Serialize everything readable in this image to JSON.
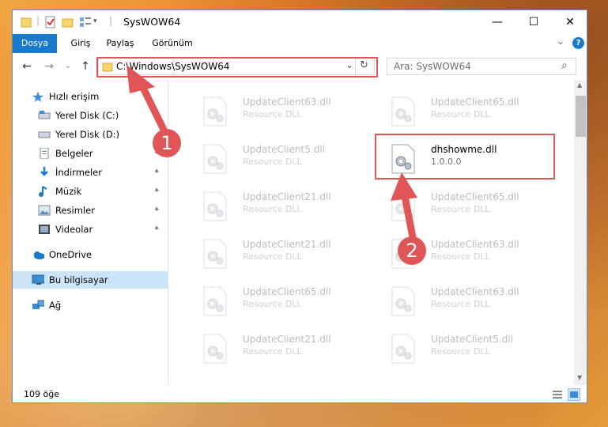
{
  "window": {
    "title": "SysWOW64",
    "minimize": "—",
    "maximize": "☐",
    "close": "✕"
  },
  "ribbon": {
    "tabs": [
      "Dosya",
      "Giriş",
      "Paylaş",
      "Görünüm"
    ],
    "expand": "⌄",
    "help": "?"
  },
  "nav": {
    "back": "←",
    "forward": "→",
    "recent": "⌄",
    "up": "↑",
    "address": "C:\\Windows\\SysWOW64",
    "dropdown": "⌄",
    "refresh": "↻",
    "search_placeholder": "Ara: SysWOW64",
    "search_icon": "⌕"
  },
  "sidebar": {
    "items": [
      {
        "label": "Hızlı erişim",
        "icon": "star-icon"
      },
      {
        "label": "Yerel Disk (C:)",
        "icon": "drive-icon",
        "pinned": true
      },
      {
        "label": "Yerel Disk (D:)",
        "icon": "drive-icon",
        "pinned": false
      },
      {
        "label": "Belgeler",
        "icon": "documents-icon",
        "pinned": true
      },
      {
        "label": "İndirmeler",
        "icon": "downloads-icon",
        "pinned": true
      },
      {
        "label": "Müzik",
        "icon": "music-icon",
        "pinned": true
      },
      {
        "label": "Resimler",
        "icon": "pictures-icon",
        "pinned": true
      },
      {
        "label": "Videolar",
        "icon": "videos-icon",
        "pinned": true
      },
      {
        "label": "OneDrive",
        "icon": "cloud-icon"
      },
      {
        "label": "Bu bilgisayar",
        "icon": "computer-icon"
      },
      {
        "label": "Ağ",
        "icon": "network-icon"
      }
    ],
    "pin_glyph": "📌"
  },
  "files": [
    {
      "name": "UpdateClient63.dll",
      "desc": "Resource DLL"
    },
    {
      "name": "UpdateClient65.dll",
      "desc": "Resource DLL"
    },
    {
      "name": "UpdateClient5.dll",
      "desc": "Resource DLL"
    },
    {
      "name": "dhshowme.dll",
      "desc": "1.0.0.0"
    },
    {
      "name": "UpdateClient21.dll",
      "desc": "Resource DLL"
    },
    {
      "name": "UpdateClient65.dll",
      "desc": "Resource DLL"
    },
    {
      "name": "UpdateClient21.dll",
      "desc": "Resource DLL"
    },
    {
      "name": "UpdateClient63.dll",
      "desc": "Resource DLL"
    },
    {
      "name": "UpdateClient65.dll",
      "desc": "Resource DLL"
    },
    {
      "name": "UpdateClient63.dll",
      "desc": "Resource DLL"
    },
    {
      "name": "UpdateClient21.dll",
      "desc": "Resource DLL"
    },
    {
      "name": "UpdateClient5.dll",
      "desc": "Resource DLL"
    }
  ],
  "status": {
    "count": "109 öğe"
  },
  "callouts": [
    "1",
    "2"
  ],
  "colors": {
    "accent": "#1979ca",
    "highlight": "#e05656",
    "selection": "#cce4f7"
  }
}
